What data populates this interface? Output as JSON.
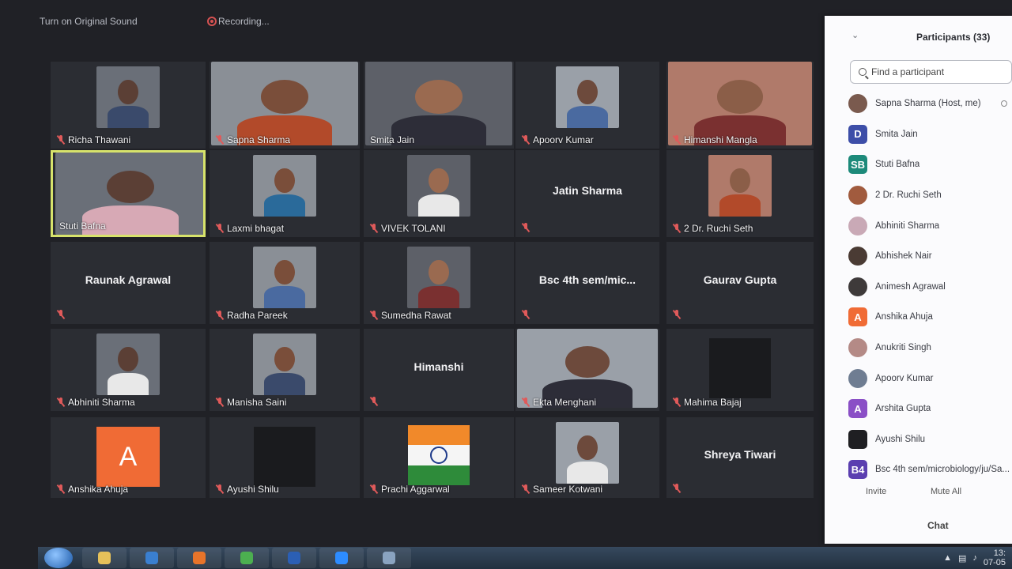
{
  "topbar": {
    "original_sound": "Turn on Original Sound",
    "recording": "Recording..."
  },
  "grid": [
    {
      "name": "Richa Thawani",
      "muted": true,
      "video": "person"
    },
    {
      "name": "Sapna Sharma",
      "muted": true,
      "video": "person"
    },
    {
      "name": "Smita Jain",
      "muted": false,
      "video": "person"
    },
    {
      "name": "Apoorv Kumar",
      "muted": true,
      "video": "person"
    },
    {
      "name": "Himanshi Mangla",
      "muted": true,
      "video": "person"
    },
    {
      "name": "Stuti Bafna",
      "muted": false,
      "video": "person",
      "speaking": true
    },
    {
      "name": "Laxmi bhagat",
      "muted": true,
      "video": "person"
    },
    {
      "name": "VIVEK TOLANI",
      "muted": true,
      "video": "person"
    },
    {
      "name": "Jatin Sharma",
      "muted": true,
      "video": "none"
    },
    {
      "name": "2 Dr. Ruchi Seth",
      "muted": true,
      "video": "person"
    },
    {
      "name": "Raunak Agrawal",
      "muted": true,
      "video": "none"
    },
    {
      "name": "Radha Pareek",
      "muted": true,
      "video": "person"
    },
    {
      "name": "Sumedha Rawat",
      "muted": true,
      "video": "person"
    },
    {
      "name": "Bsc 4th sem/mic...",
      "muted": true,
      "video": "none"
    },
    {
      "name": "Gaurav Gupta",
      "muted": true,
      "video": "none"
    },
    {
      "name": "Abhiniti Sharma",
      "muted": true,
      "video": "person"
    },
    {
      "name": "Manisha Saini",
      "muted": true,
      "video": "person"
    },
    {
      "name": "Himanshi",
      "muted": true,
      "video": "none"
    },
    {
      "name": "Ekta Menghani",
      "muted": true,
      "video": "person"
    },
    {
      "name": "Mahima Bajaj",
      "muted": true,
      "video": "black"
    },
    {
      "name": "Anshika Ahuja",
      "muted": true,
      "video": "avatar",
      "avatar_letter": "A"
    },
    {
      "name": "Ayushi Shilu",
      "muted": true,
      "video": "black"
    },
    {
      "name": "Prachi Aggarwal",
      "muted": true,
      "video": "flag"
    },
    {
      "name": "Sameer Kotwani",
      "muted": true,
      "video": "person"
    },
    {
      "name": "Shreya Tiwari",
      "muted": true,
      "video": "none"
    }
  ],
  "participants_panel": {
    "title": "Participants (33)",
    "search_placeholder": "Find a participant",
    "participants": [
      {
        "name": "Sapna Sharma (Host, me)",
        "avatar_type": "photo",
        "color": "#7a5a4e"
      },
      {
        "name": "Smita Jain",
        "avatar_type": "letter",
        "letter": "D",
        "color": "#3d4ea8"
      },
      {
        "name": "Stuti Bafna",
        "avatar_type": "letter",
        "letter": "SB",
        "color": "#1d8a7a"
      },
      {
        "name": "2 Dr. Ruchi Seth",
        "avatar_type": "photo",
        "color": "#a15b3e"
      },
      {
        "name": "Abhiniti Sharma",
        "avatar_type": "photo",
        "color": "#c9a9b6"
      },
      {
        "name": "Abhishek Nair",
        "avatar_type": "photo",
        "color": "#4a3b34"
      },
      {
        "name": "Animesh Agrawal",
        "avatar_type": "photo",
        "color": "#3e3a3a"
      },
      {
        "name": "Anshika Ahuja",
        "avatar_type": "letter",
        "letter": "A",
        "color": "#f06b35"
      },
      {
        "name": "Anukriti Singh",
        "avatar_type": "photo",
        "color": "#b48a86"
      },
      {
        "name": "Apoorv Kumar",
        "avatar_type": "photo",
        "color": "#6f7d92"
      },
      {
        "name": "Arshita Gupta",
        "avatar_type": "letter",
        "letter": "A",
        "color": "#8a4fc6"
      },
      {
        "name": "Ayushi Shilu",
        "avatar_type": "letter",
        "letter": "",
        "color": "#1f1f22"
      },
      {
        "name": "Bsc 4th sem/microbiology/ju/Sa...",
        "avatar_type": "letter",
        "letter": "B4",
        "color": "#5b3fb0"
      }
    ],
    "invite_label": "Invite",
    "mute_all_label": "Mute All",
    "chat_label": "Chat"
  },
  "taskbar": {
    "apps": [
      "Explorer",
      "Media",
      "Firefox",
      "Chrome",
      "Word",
      "Zoom",
      "Files"
    ],
    "time": "13:",
    "date": "07-05"
  }
}
